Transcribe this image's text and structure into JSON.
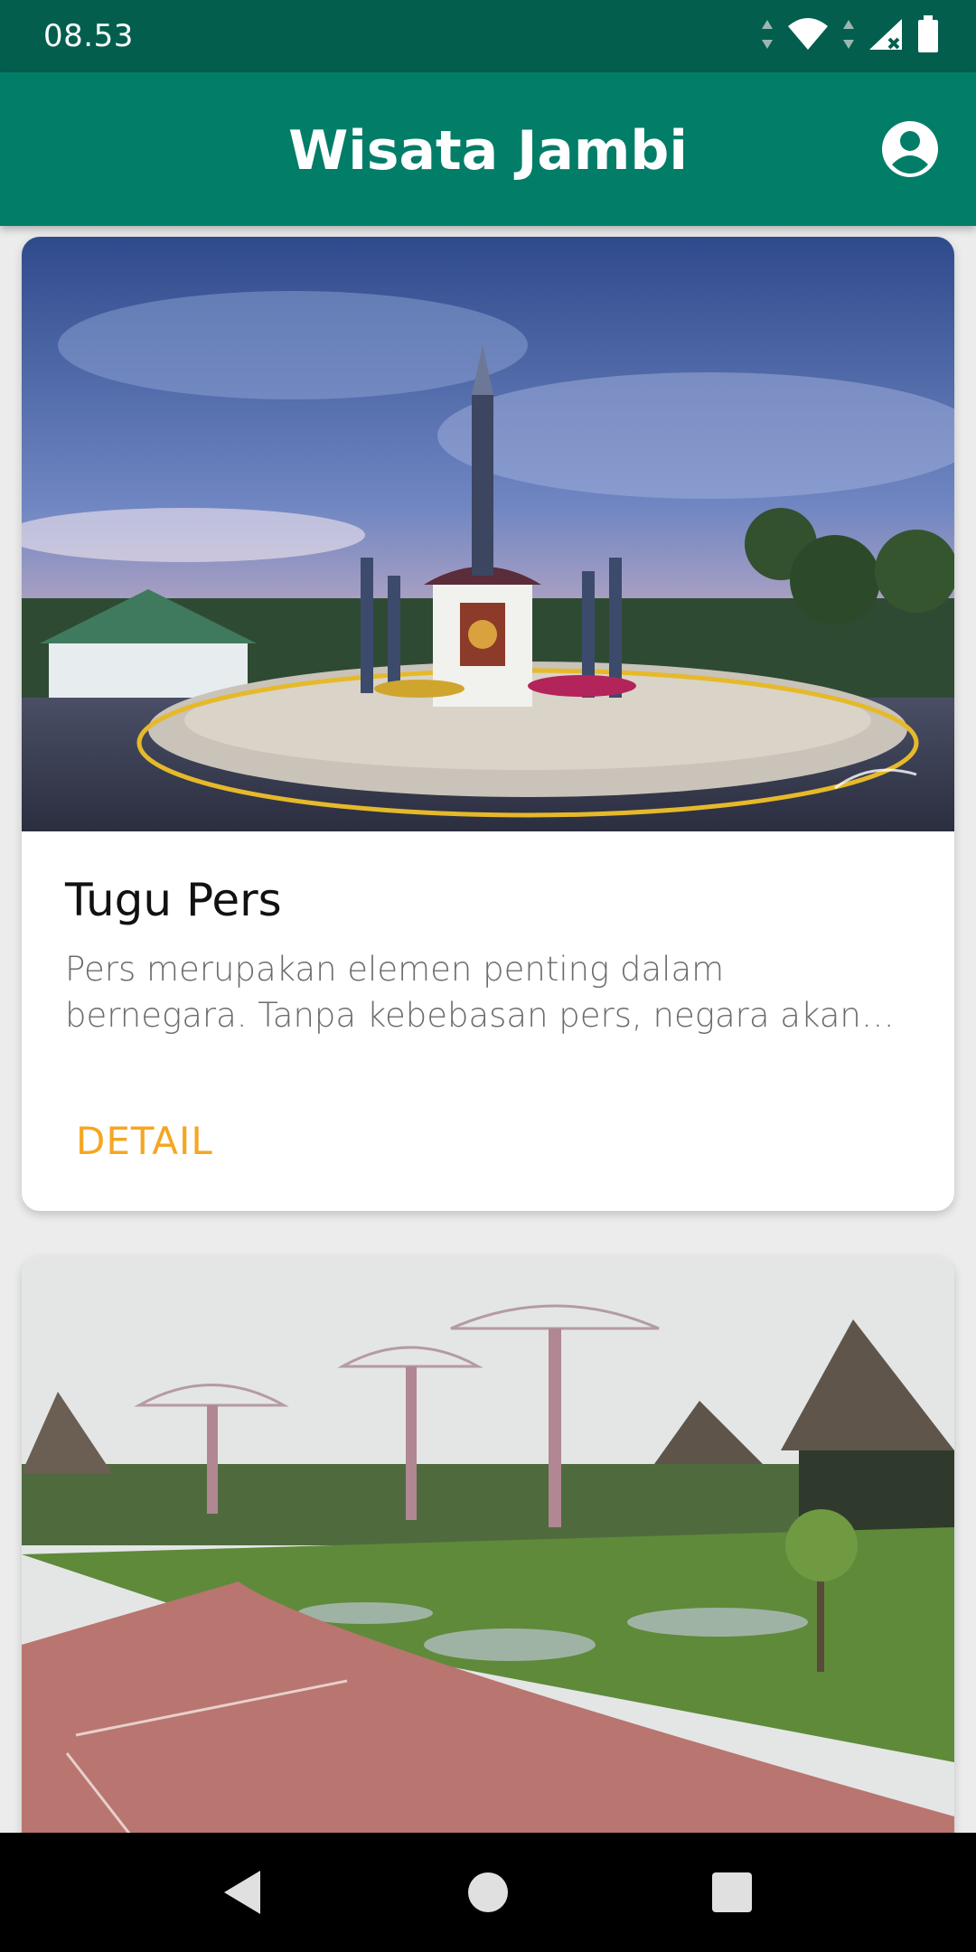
{
  "status_bar": {
    "time": "08.53",
    "icons": [
      "data-arrows-icon",
      "wifi-icon",
      "signal-icon",
      "battery-icon"
    ]
  },
  "app_bar": {
    "title": "Wisata Jambi",
    "account_icon": "account-circle-icon"
  },
  "cards": [
    {
      "title": "Tugu Pers",
      "description": "Pers merupakan elemen penting dalam bernegara. Tanpa kebebasan pers, negara akan cenderung otoriter.",
      "button_label": "DETAIL",
      "image": "tugu-pers-monument-photo"
    },
    {
      "title": "",
      "description": "",
      "button_label": "",
      "image": "park-with-tree-structures-photo"
    }
  ],
  "nav_bar": {
    "items": [
      "back-icon",
      "home-icon",
      "recents-icon"
    ]
  },
  "colors": {
    "status_bar": "#045e4e",
    "app_bar": "#027d68",
    "accent": "#f5a623",
    "background": "#ececec"
  }
}
